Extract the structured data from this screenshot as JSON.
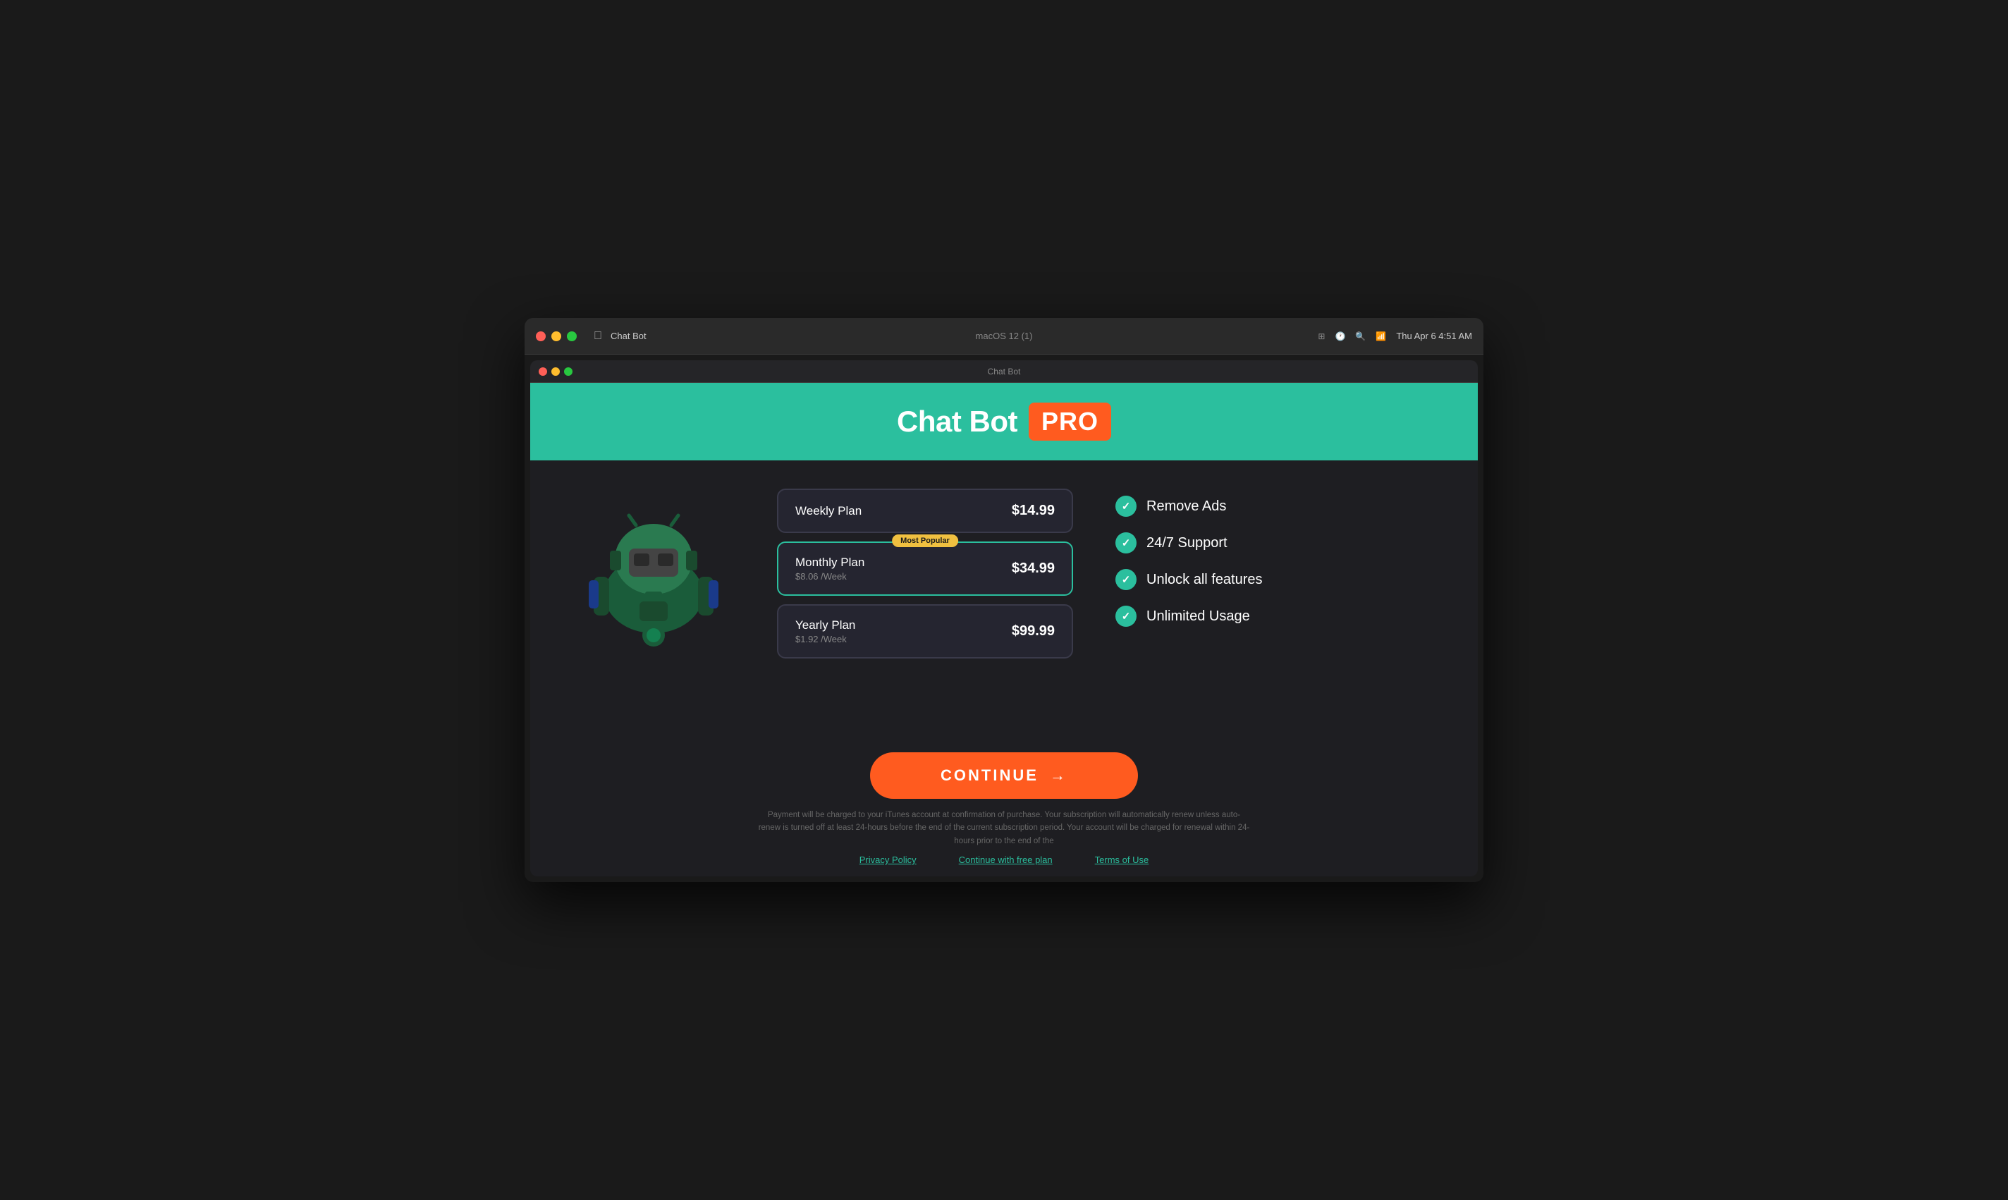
{
  "os": {
    "title": "macOS 12 (1)",
    "app_name": "Chat Bot",
    "time": "Thu Apr 6  4:51 AM",
    "inner_title": "Chat Bot"
  },
  "header": {
    "chat_bot_label": "Chat Bot",
    "pro_label": "PRO"
  },
  "plans": [
    {
      "id": "weekly",
      "name": "Weekly Plan",
      "sub": "",
      "price": "$14.99",
      "selected": false,
      "badge": null
    },
    {
      "id": "monthly",
      "name": "Monthly Plan",
      "sub": "$8.06 /Week",
      "price": "$34.99",
      "selected": true,
      "badge": "Most Popular"
    },
    {
      "id": "yearly",
      "name": "Yearly Plan",
      "sub": "$1.92 /Week",
      "price": "$99.99",
      "selected": false,
      "badge": null
    }
  ],
  "features": [
    {
      "label": "Remove Ads"
    },
    {
      "label": "24/7 Support"
    },
    {
      "label": "Unlock all features"
    },
    {
      "label": "Unlimited Usage"
    }
  ],
  "cta": {
    "label": "CONTINUE",
    "arrow": "→"
  },
  "footer": {
    "disclaimer": "Payment will be charged to your iTunes account at confirmation of purchase. Your subscription will automatically renew unless auto-renew is turned off at least 24-hours before the end of the current subscription period. Your account will be charged for renewal within 24-hours prior to the end of the",
    "links": [
      {
        "label": "Privacy Policy"
      },
      {
        "label": "Continue with free plan"
      },
      {
        "label": "Terms of Use"
      }
    ]
  },
  "colors": {
    "teal": "#2bbf9e",
    "orange": "#ff5b1f",
    "yellow": "#f0c040",
    "dark_bg": "#1e1e22",
    "card_bg": "#252530",
    "text_white": "#ffffff",
    "text_muted": "#888888"
  }
}
